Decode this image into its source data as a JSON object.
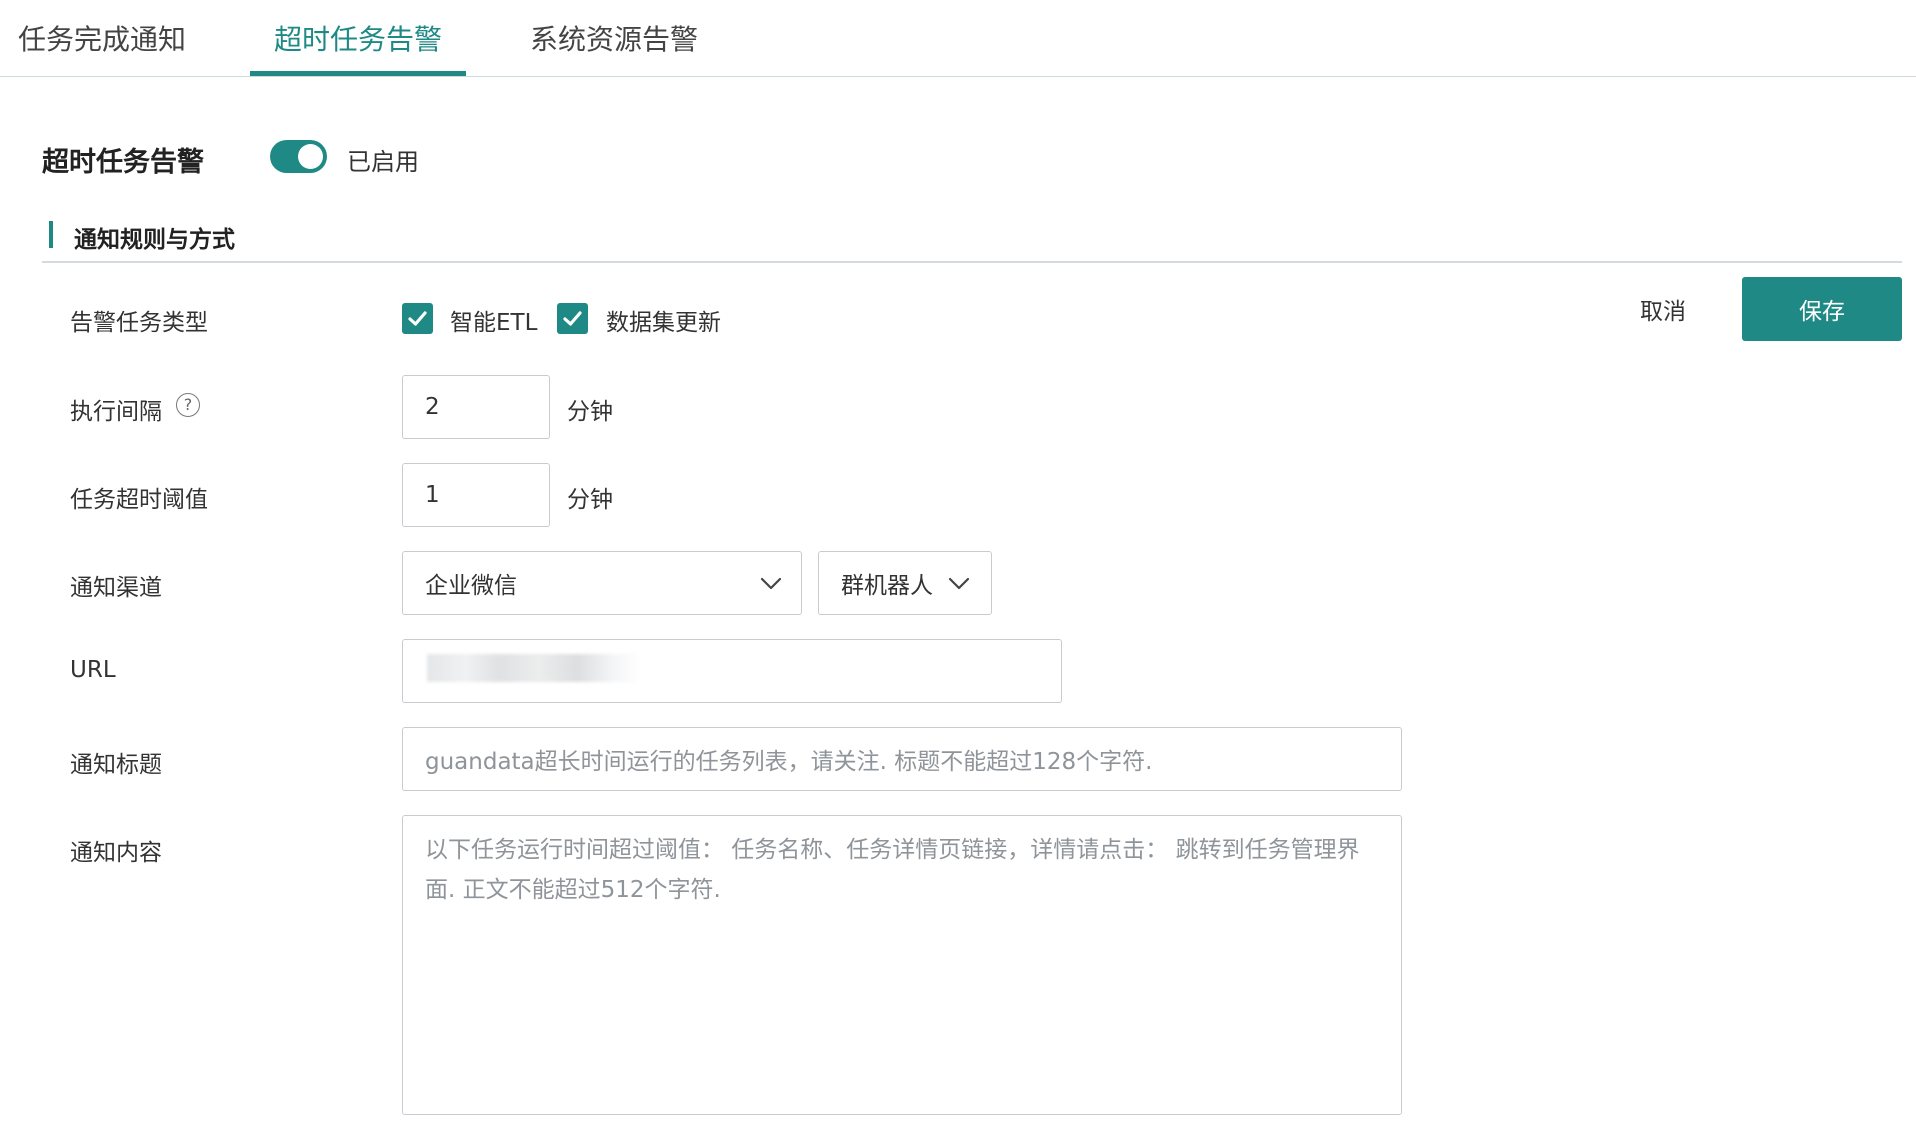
{
  "tabs": [
    {
      "label": "任务完成通知",
      "active": false
    },
    {
      "label": "超时任务告警",
      "active": true
    },
    {
      "label": "系统资源告警",
      "active": false
    }
  ],
  "header": {
    "title": "超时任务告警",
    "toggle_label": "已启用",
    "toggle_on": true
  },
  "section": {
    "title": "通知规则与方式"
  },
  "actions": {
    "cancel_label": "取消",
    "save_label": "保存"
  },
  "form": {
    "task_type": {
      "label": "告警任务类型",
      "options": [
        {
          "label": "智能ETL",
          "checked": true
        },
        {
          "label": "数据集更新",
          "checked": true
        }
      ]
    },
    "interval": {
      "label": "执行间隔",
      "value": "2",
      "unit": "分钟"
    },
    "threshold": {
      "label": "任务超时阈值",
      "value": "1",
      "unit": "分钟"
    },
    "channel": {
      "label": "通知渠道",
      "selected": "企业微信",
      "sub_selected": "群机器人"
    },
    "url": {
      "label": "URL"
    },
    "notify_title": {
      "label": "通知标题",
      "placeholder": "guandata超长时间运行的任务列表，请关注. 标题不能超过128个字符."
    },
    "notify_content": {
      "label": "通知内容",
      "placeholder": "以下任务运行时间超过阈值： 任务名称、任务详情页链接，详情请点击： 跳转到任务管理界面. 正文不能超过512个字符."
    }
  },
  "colors": {
    "accent": "#1f8a85"
  }
}
